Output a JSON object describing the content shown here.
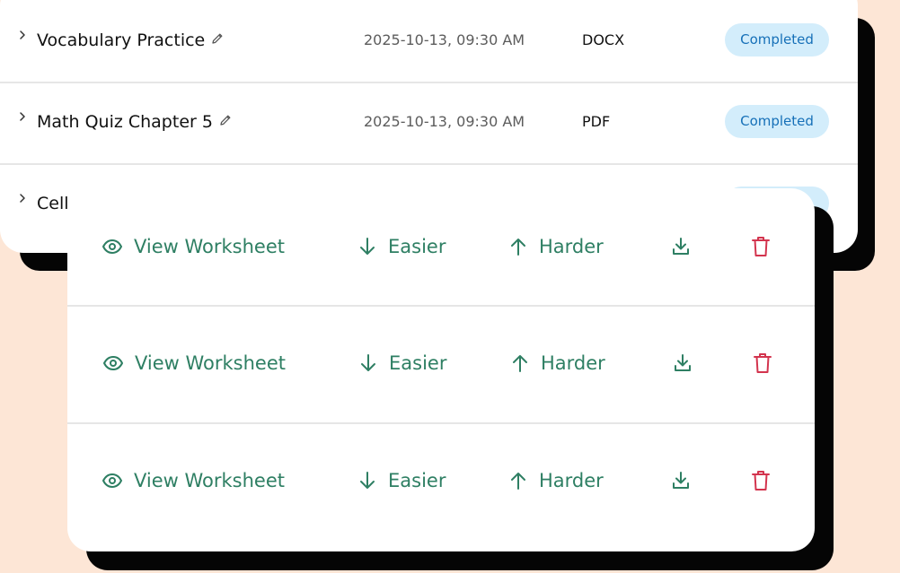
{
  "colors": {
    "background": "#fde6d6",
    "action_green": "#2e7f63",
    "delete_red": "#d3344e",
    "badge_bg": "#d3edfb",
    "badge_text": "#1670b8"
  },
  "files": [
    {
      "name": "Vocabulary Practice",
      "date": "2025-10-13, 09:30 AM",
      "type": "DOCX",
      "status": "Completed"
    },
    {
      "name": "Math Quiz Chapter 5",
      "date": "2025-10-13, 09:30 AM",
      "type": "PDF",
      "status": "Completed"
    },
    {
      "name": "Cell"
    }
  ],
  "actions": {
    "view_label": "View Worksheet",
    "easier_label": "Easier",
    "harder_label": "Harder",
    "icons": [
      "eye-icon",
      "arrow-down-icon",
      "arrow-up-icon",
      "download-icon",
      "trash-icon"
    ]
  }
}
